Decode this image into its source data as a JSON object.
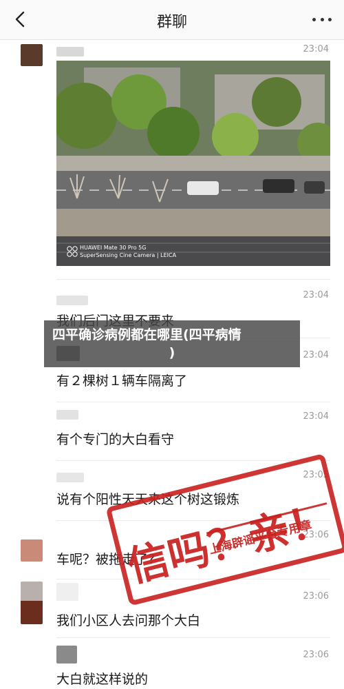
{
  "header": {
    "title": "群聊",
    "back_icon": "chevron-left-icon",
    "more_icon": "more-dots-icon"
  },
  "photo_watermark": {
    "line1": "HUAWEI Mate 30 Pro 5G",
    "line2": "SuperSensing Cine Camera | LEICA"
  },
  "messages": [
    {
      "time": "23:04",
      "avatar_color": "#5a3a2a",
      "type": "image"
    },
    {
      "time": "23:04",
      "avatar_color": null,
      "text": "我们后门这里不要来"
    },
    {
      "time": "23:04",
      "avatar_color": null,
      "text": "有２棵树１辆车隔离了"
    },
    {
      "time": "23:04",
      "avatar_color": null,
      "text": "有个专门的大白看守"
    },
    {
      "time": "23:05",
      "avatar_color": null,
      "text": "说有个阳性天天来这个树这锻炼"
    },
    {
      "time": "23:06",
      "avatar_color": "#c98a78",
      "text": "车呢？被拖走了？"
    },
    {
      "time": "23:06",
      "avatar_color": "#6b2e1e",
      "text": "我们小区人去问那个大白"
    },
    {
      "time": "23:06",
      "avatar_color": null,
      "text": "大白就这样说的"
    }
  ],
  "headline": {
    "line1": "四平确诊病例都在哪里(四平病情",
    "line2": ")"
  },
  "stamp": {
    "main": "信吗？亲！",
    "sub": "上海辟谣平台专用章",
    "color": "#c8201e"
  }
}
